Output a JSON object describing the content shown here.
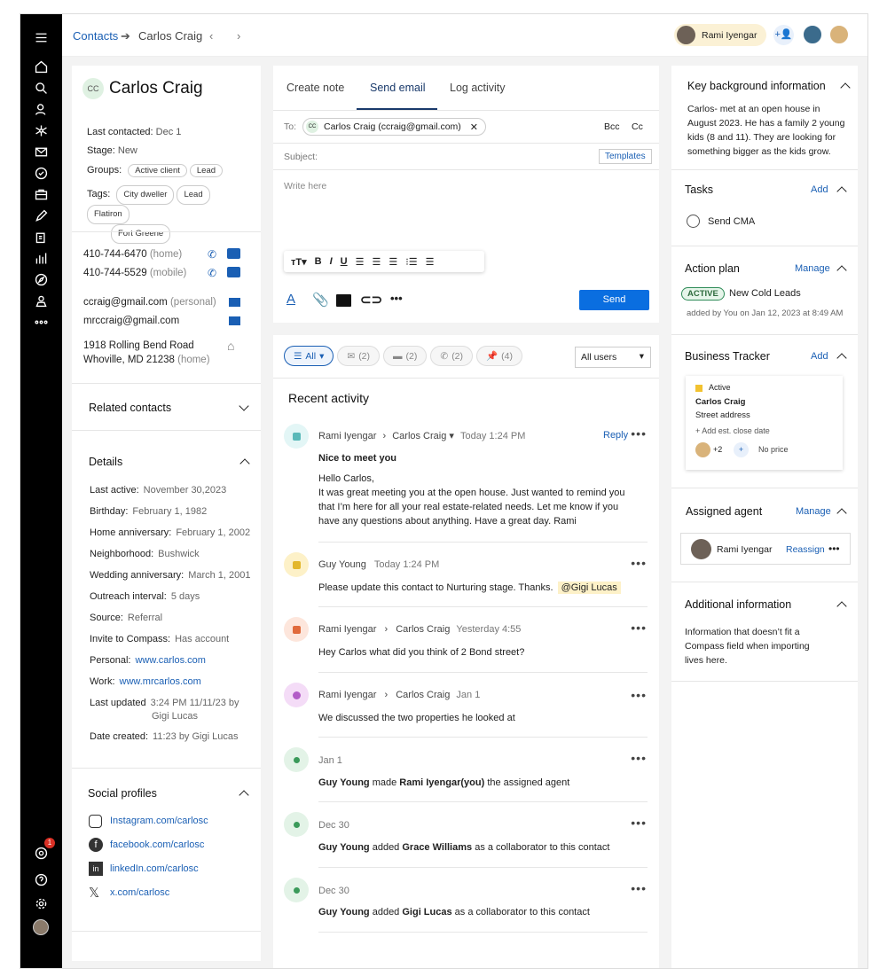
{
  "breadcrumb": {
    "root": "Contacts",
    "current": "Carlos Craig"
  },
  "header": {
    "user_name": "Rami Iyengar"
  },
  "contact": {
    "initials": "CC",
    "name": "Carlos Craig",
    "last_contacted_label": "Last contacted:",
    "last_contacted": "Dec 1",
    "stage_label": "Stage:",
    "stage": "New",
    "groups_label": "Groups:",
    "groups": [
      "Active client",
      "Lead"
    ],
    "tags_label": "Tags:",
    "tags": [
      "City dweller",
      "Lead",
      "Flatiron",
      "Fort Greene"
    ],
    "phones": [
      {
        "number": "410-744-6470",
        "type": "(home)"
      },
      {
        "number": "410-744-5529",
        "type": "(mobile)"
      }
    ],
    "emails": [
      {
        "address": "ccraig@gmail.com",
        "type": "(personal)"
      },
      {
        "address": "mrccraig@gmail.com",
        "type": ""
      }
    ],
    "address_line1": "1918 Rolling Bend Road",
    "address_line2": "Whoville, MD 21238",
    "address_type": "(home)"
  },
  "related": {
    "title": "Related contacts"
  },
  "details": {
    "title": "Details",
    "rows": [
      {
        "label": "Last active:",
        "value": "November 30,2023"
      },
      {
        "label": "Birthday:",
        "value": "February 1, 1982"
      },
      {
        "label": "Home anniversary:",
        "value": "February 1, 2002"
      },
      {
        "label": "Neighborhood:",
        "value": "Bushwick"
      },
      {
        "label": "Wedding anniversary:",
        "value": "March 1, 2001"
      },
      {
        "label": "Outreach interval:",
        "value": "5 days"
      },
      {
        "label": "Source:",
        "value": "Referral"
      },
      {
        "label": "Invite to Compass:",
        "value": "Has account"
      },
      {
        "label": "Personal:",
        "value": "www.carlos.com"
      },
      {
        "label": "Work:",
        "value": "www.mrcarlos.com"
      },
      {
        "label": "Last updated",
        "value": "3:24 PM 11/11/23 by",
        "value2": "Gigi Lucas"
      },
      {
        "label": "Date created:",
        "value": "11:23 by Gigi Lucas"
      }
    ]
  },
  "social": {
    "title": "Social profiles",
    "links": [
      "Instagram.com/carlosc",
      "facebook.com/carlosc",
      "linkedIn.com/carlosc",
      "x.com/carlosc"
    ]
  },
  "composer": {
    "tabs": [
      "Create note",
      "Send email",
      "Log activity"
    ],
    "to_label": "To:",
    "recipient_initials": "CC",
    "recipient": "Carlos Craig (ccraig@gmail.com)",
    "bcc": "Bcc",
    "cc": "Cc",
    "subject_label": "Subject:",
    "templates": "Templates",
    "body_placeholder": "Write here",
    "send": "Send"
  },
  "filters": {
    "all": "All",
    "email_count": "(2)",
    "note_count": "(2)",
    "call_count": "(2)",
    "pin_count": "(4)",
    "users": "All users"
  },
  "activity": {
    "title": "Recent activity",
    "items": [
      {
        "from": "Rami Iyengar",
        "to": "Carlos Craig",
        "time": "Today 1:24 PM",
        "reply": "Reply",
        "subject": "Nice to meet you",
        "body": [
          "Hello Carlos,",
          "It was great meeting you at the open house. Just wanted to remind you",
          "that I’m here for all your real estate-related needs. Let me know if you",
          "have any questions about anything. Have a great day. Rami"
        ]
      },
      {
        "from": "Guy Young",
        "time": "Today 1:24 PM",
        "body": "Please update this contact to Nurturing stage. Thanks.",
        "mention": "@Gigi Lucas"
      },
      {
        "from": "Rami Iyengar",
        "to": "Carlos Craig",
        "time": "Yesterday 4:55",
        "body": "Hey Carlos what did you think of 2 Bond street?"
      },
      {
        "from": "Rami Iyengar",
        "to": "Carlos Craig",
        "time": "Jan 1",
        "body": "We discussed the two properties he looked at"
      },
      {
        "time": "Jan 1",
        "actor": "Guy Young",
        "verb": " made ",
        "object": "Rami Iyengar(you)",
        "rest": " the assigned agent"
      },
      {
        "time": "Dec 30",
        "actor": "Guy Young",
        "verb": " added ",
        "object": "Grace Williams",
        "rest": " as a collaborator to this contact"
      },
      {
        "time": "Dec 30",
        "actor": "Guy Young",
        "verb": " added ",
        "object": "Gigi Lucas",
        "rest": " as a collaborator to this contact"
      }
    ]
  },
  "right": {
    "background_title": "Key background information",
    "background_text": [
      "Carlos- met at an open house in",
      "August 2023. He has a family 2 young",
      "kids (8 and 11). They are looking for",
      "something bigger as the kids grow."
    ],
    "tasks_title": "Tasks",
    "add": "Add",
    "task": "Send CMA",
    "plan_title": "Action plan",
    "manage": "Manage",
    "plan_status": "ACTIVE",
    "plan_name": "New Cold Leads",
    "plan_meta": "added by You on Jan 12, 2023 at 8:49 AM",
    "tracker_title": "Business Tracker",
    "tracker_status": "Active",
    "tracker_name": "Carlos Craig",
    "tracker_address": "Street address",
    "tracker_close": "+ Add est. close date",
    "tracker_more": "+2",
    "tracker_price": "No price",
    "agent_title": "Assigned agent",
    "agent_name": "Rami Iyengar",
    "reassign": "Reassign",
    "additional_title": "Additional information",
    "additional_text": [
      "Information that doesn’t fit a",
      "Compass field when importing",
      "lives here."
    ]
  },
  "notifications": {
    "count": "1"
  },
  "colors": {
    "accent": "#1a5fb4",
    "send_button": "#0a6ee0",
    "active_badge": "#2e8b57"
  }
}
